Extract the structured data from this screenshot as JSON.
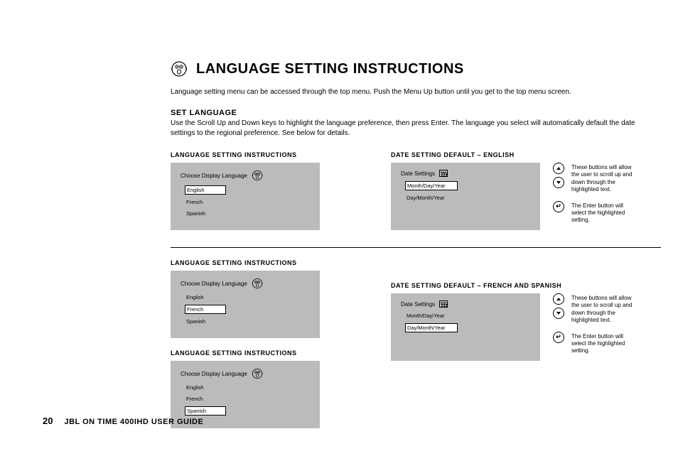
{
  "title": "LANGUAGE SETTING INSTRUCTIONS",
  "intro": "Language setting menu can be accessed through the top menu. Push the Menu Up button until you get to the top menu screen.",
  "set_language_heading": "SET LANGUAGE",
  "set_language_text": "Use the Scroll Up and Down keys to highlight the language preference, then press Enter. The language you select will automatically default the date settings to the regional preference. See below for details.",
  "blocks": {
    "lang_instructions_title": "LANGUAGE SETTING INSTRUCTIONS",
    "date_default_english_title": "DATE SETTING DEFAULT – ENGLISH",
    "date_default_french_spanish_title": "DATE SETTING DEFAULT – FRENCH AND SPANISH"
  },
  "language_panel": {
    "label": "Choose Display Language",
    "options": [
      "English",
      "French",
      "Spanish"
    ]
  },
  "date_panel": {
    "label": "Date Settings",
    "options": [
      "Month/Day/Year",
      "Day/Month/Year"
    ]
  },
  "controls": {
    "scroll_text": "These buttons will allow the user to scroll up and down through the highlighted text.",
    "enter_text": "The Enter button will select the highlighted setting."
  },
  "footer": {
    "page_number": "20",
    "guide_title": "JBL ON TIME 400iHD USER GUIDE"
  }
}
